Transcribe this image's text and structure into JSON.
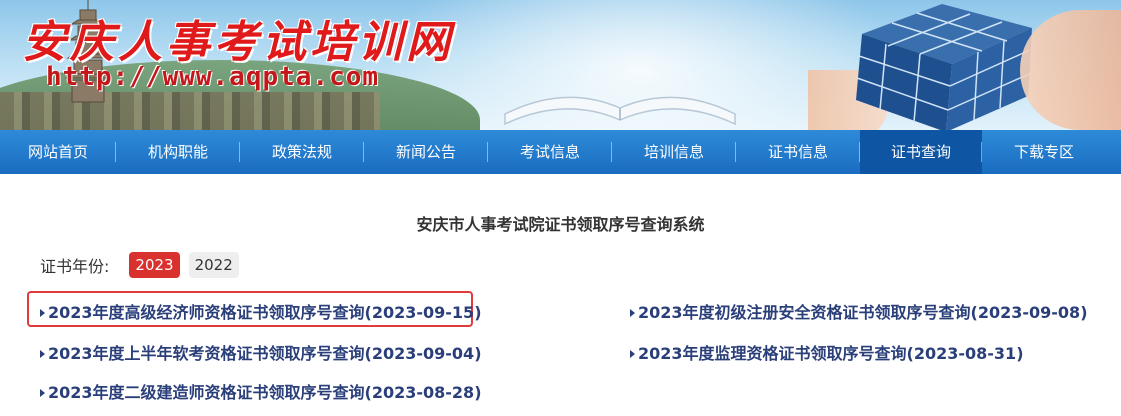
{
  "banner": {
    "site_title": "安庆人事考试培训网",
    "site_url": "http://www.aqpta.com"
  },
  "nav": {
    "items": [
      {
        "label": "网站首页"
      },
      {
        "label": "机构职能"
      },
      {
        "label": "政策法规"
      },
      {
        "label": "新闻公告"
      },
      {
        "label": "考试信息"
      },
      {
        "label": "培训信息"
      },
      {
        "label": "证书信息"
      },
      {
        "label": "证书查询",
        "active": true
      },
      {
        "label": "下载专区"
      }
    ]
  },
  "main": {
    "title": "安庆市人事考试院证书领取序号查询系统",
    "year_label": "证书年份:",
    "years": [
      {
        "label": "2023",
        "active": true
      },
      {
        "label": "2022",
        "active": false
      }
    ],
    "links": [
      {
        "text": "2023年度高级经济师资格证书领取序号查询(2023-09-15)",
        "highlighted": true
      },
      {
        "text": "2023年度初级注册安全资格证书领取序号查询(2023-09-08)"
      },
      {
        "text": "2023年度上半年软考资格证书领取序号查询(2023-09-04)"
      },
      {
        "text": "2023年度监理资格证书领取序号查询(2023-08-31)"
      },
      {
        "text": "2023年度二级建造师资格证书领取序号查询(2023-08-28)"
      }
    ]
  },
  "colors": {
    "nav_blue": "#1a6cc0",
    "nav_active": "#0e56a4",
    "year_active": "#d9312e",
    "link_color": "#2a3f7a",
    "highlight_border": "#e03a3a"
  }
}
